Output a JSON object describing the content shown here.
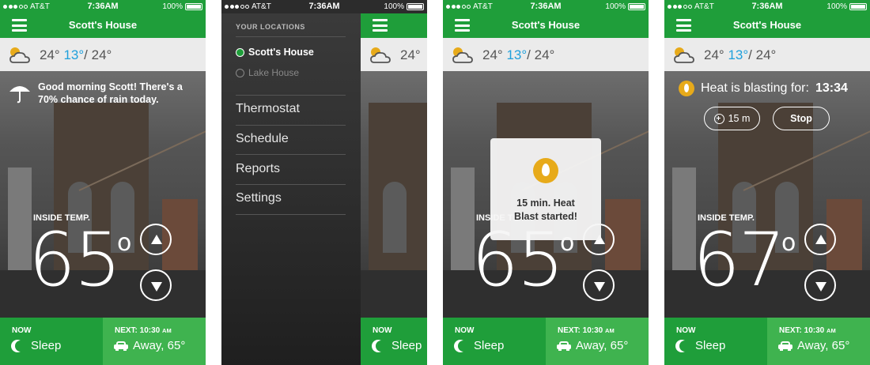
{
  "status_bar": {
    "carrier": "AT&T",
    "time": "7:36AM",
    "battery": "100%"
  },
  "header": {
    "title": "Scott's House"
  },
  "weather": {
    "current": "24°",
    "low": "13°",
    "separator": "/",
    "high": "24°",
    "icon": "partly-cloudy-icon"
  },
  "message": "Good morning Scott! There's a 70% chance of rain today.",
  "inside_label": "INSIDE TEMP.",
  "temperatures": {
    "screen1": "65",
    "screen3": "65",
    "screen4": "67",
    "degree": "o"
  },
  "footer": {
    "now_label": "NOW",
    "now_value": "Sleep",
    "next_label": "NEXT: 10:30",
    "next_am": "AM",
    "next_value": "Away, 65°"
  },
  "drawer": {
    "heading": "YOUR LOCATIONS",
    "locations": [
      {
        "label": "Scott's House",
        "active": true
      },
      {
        "label": "Lake House",
        "active": false
      }
    ],
    "items": [
      "Thermostat",
      "Schedule",
      "Reports",
      "Settings"
    ]
  },
  "toast": {
    "line1": "15 min. Heat",
    "line2": "Blast started!"
  },
  "heat_blast": {
    "label": "Heat is blasting for:",
    "timer": "13:34",
    "add_label": "15 m",
    "stop_label": "Stop"
  },
  "colors": {
    "green": "#1f9e3a",
    "light_green": "#3fb34f",
    "low_temp_blue": "#1fa0dc",
    "flame": "#e7aa1a"
  }
}
